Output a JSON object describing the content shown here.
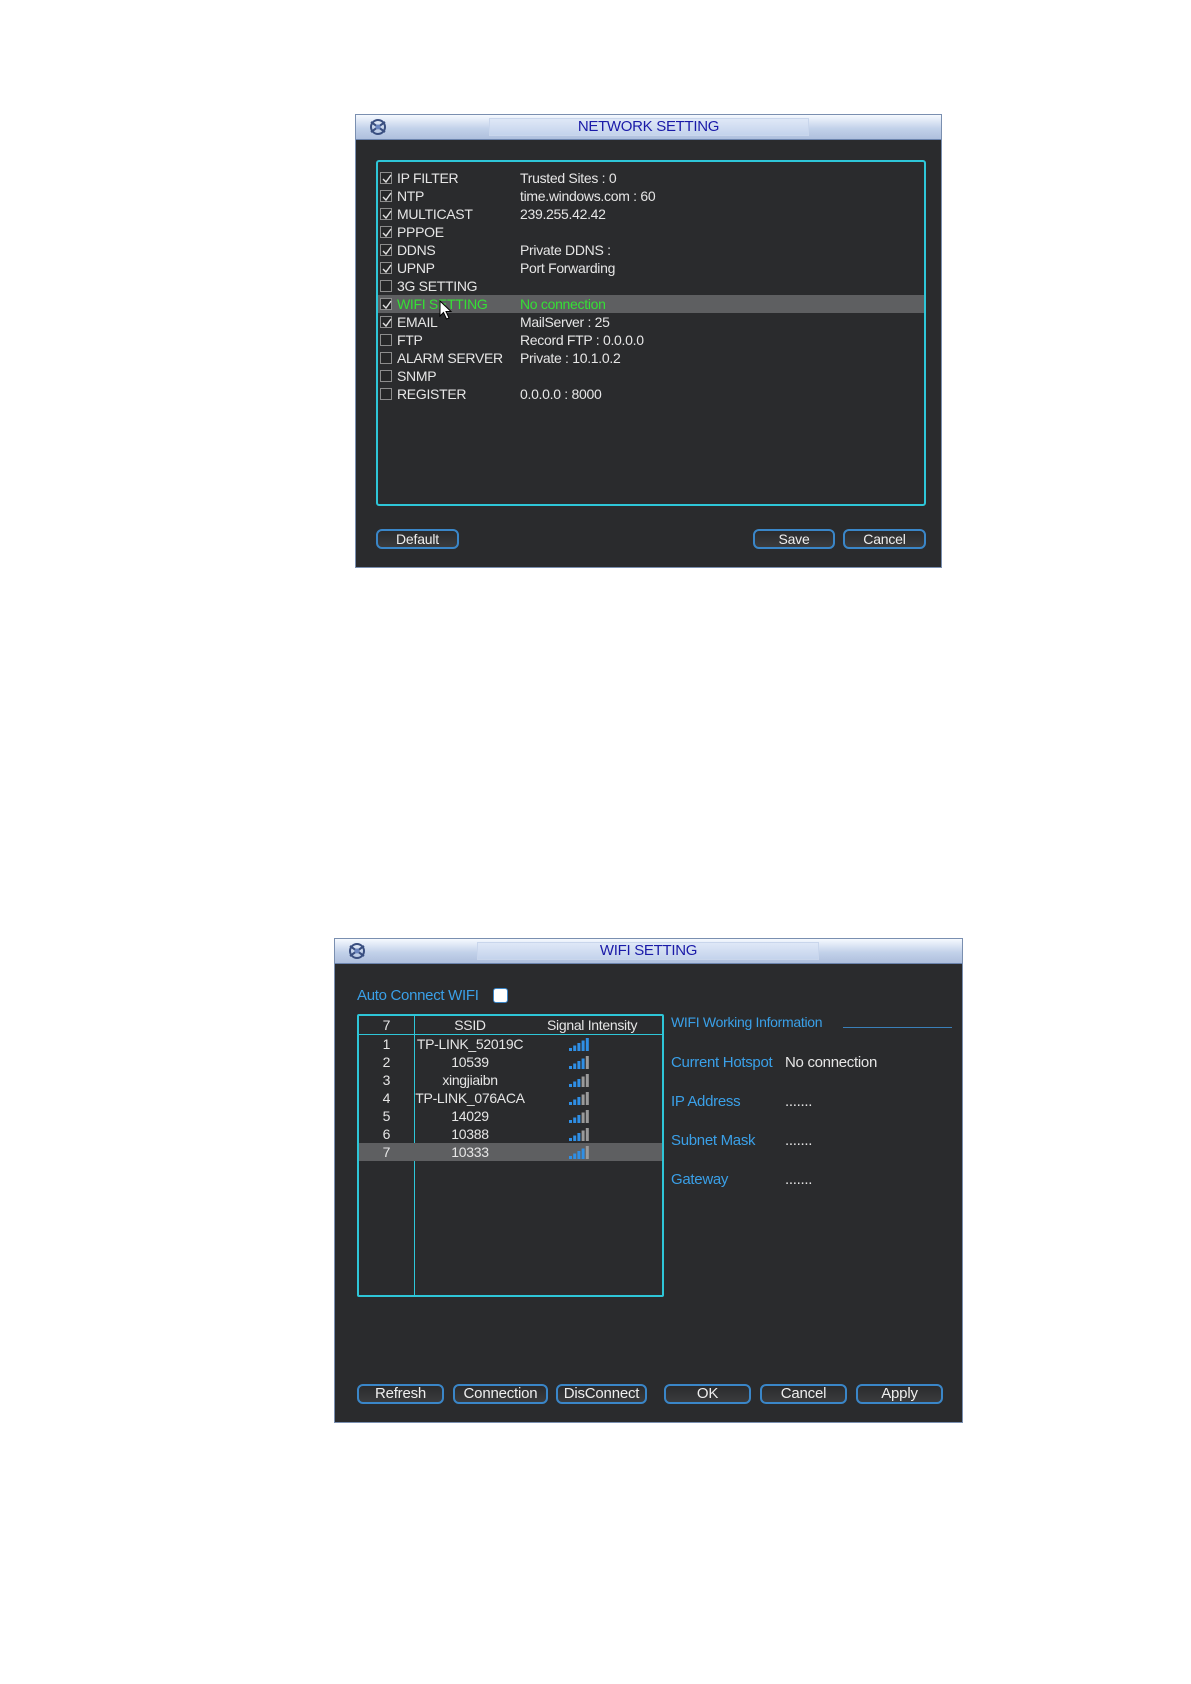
{
  "network": {
    "title": "NETWORK SETTING",
    "items": [
      {
        "label": "IP FILTER",
        "value": "Trusted Sites : 0",
        "checked": true,
        "selected": false
      },
      {
        "label": "NTP",
        "value": "time.windows.com : 60",
        "checked": true,
        "selected": false
      },
      {
        "label": "MULTICAST",
        "value": "239.255.42.42",
        "checked": true,
        "selected": false
      },
      {
        "label": "PPPOE",
        "value": "",
        "checked": true,
        "selected": false
      },
      {
        "label": "DDNS",
        "value": "Private DDNS :",
        "checked": true,
        "selected": false
      },
      {
        "label": "UPNP",
        "value": "Port Forwarding",
        "checked": true,
        "selected": false
      },
      {
        "label": "3G SETTING",
        "value": "",
        "checked": false,
        "selected": false
      },
      {
        "label": "WIFI SETTING",
        "value": "No connection",
        "checked": true,
        "selected": true
      },
      {
        "label": "EMAIL",
        "value": "MailServer : 25",
        "checked": true,
        "selected": false
      },
      {
        "label": "FTP",
        "value": "Record FTP : 0.0.0.0",
        "checked": false,
        "selected": false
      },
      {
        "label": "ALARM SERVER",
        "value": "Private : 10.1.0.2",
        "checked": false,
        "selected": false
      },
      {
        "label": "SNMP",
        "value": "",
        "checked": false,
        "selected": false
      },
      {
        "label": "REGISTER",
        "value": "0.0.0.0 : 8000",
        "checked": false,
        "selected": false
      }
    ],
    "buttons": {
      "default": "Default",
      "save": "Save",
      "cancel": "Cancel"
    }
  },
  "wifi": {
    "title": "WIFI SETTING",
    "auto_connect_label": "Auto Connect WIFI",
    "auto_connect_checked": false,
    "table": {
      "count": "7",
      "col_ssid": "SSID",
      "col_signal": "Signal Intensity",
      "rows": [
        {
          "num": "1",
          "ssid": "TP-LINK_52019C",
          "signal": 5,
          "selected": false
        },
        {
          "num": "2",
          "ssid": "10539",
          "signal": 4,
          "selected": false
        },
        {
          "num": "3",
          "ssid": "xingjiaibn",
          "signal": 3,
          "selected": false
        },
        {
          "num": "4",
          "ssid": "TP-LINK_076ACA",
          "signal": 3,
          "selected": false
        },
        {
          "num": "5",
          "ssid": "14029",
          "signal": 3,
          "selected": false
        },
        {
          "num": "6",
          "ssid": "10388",
          "signal": 3,
          "selected": false
        },
        {
          "num": "7",
          "ssid": "10333",
          "signal": 4,
          "selected": true
        }
      ]
    },
    "info": {
      "heading": "WIFI Working Information",
      "current_hotspot_label": "Current Hotspot",
      "current_hotspot_value": "No connection",
      "ip_label": "IP Address",
      "ip_value": ".......",
      "mask_label": "Subnet Mask",
      "mask_value": ".......",
      "gateway_label": "Gateway",
      "gateway_value": "......."
    },
    "buttons": {
      "refresh": "Refresh",
      "connection": "Connection",
      "disconnect": "DisConnect",
      "ok": "OK",
      "cancel": "Cancel",
      "apply": "Apply"
    }
  },
  "colors": {
    "accent_cyan": "#2ec6d8",
    "selected_green": "#35e035",
    "info_blue": "#3aa0e8"
  }
}
